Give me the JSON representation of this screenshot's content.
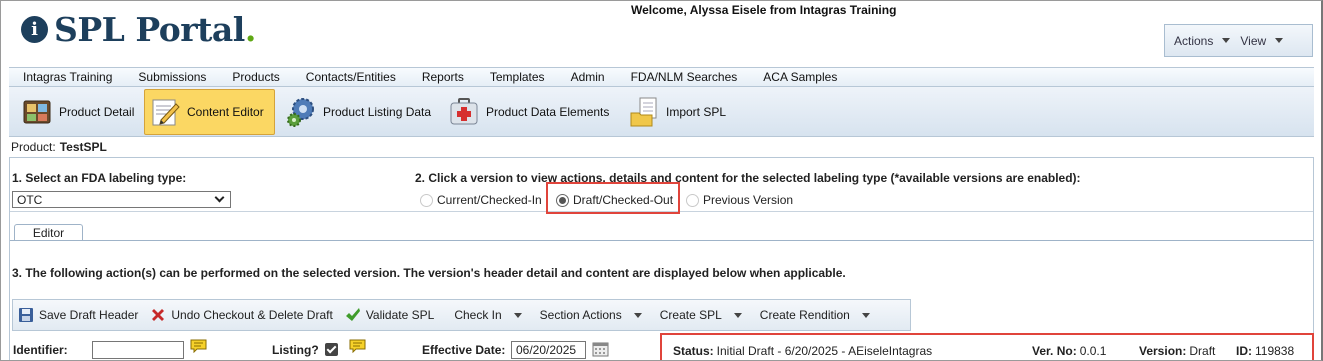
{
  "header": {
    "logo_i": "i",
    "logo_text": "SPL Portal",
    "logo_dot": ".",
    "welcome": "Welcome, Alyssa Eisele from Intagras Training",
    "actions_label": "Actions",
    "view_label": "View"
  },
  "menu": [
    "Intagras Training",
    "Submissions",
    "Products",
    "Contacts/Entities",
    "Reports",
    "Templates",
    "Admin",
    "FDA/NLM Searches",
    "ACA Samples"
  ],
  "toolbar": {
    "product_detail": "Product Detail",
    "content_editor": "Content Editor",
    "product_listing_data": "Product Listing Data",
    "product_data_elements": "Product Data Elements",
    "import_spl": "Import SPL"
  },
  "product": {
    "label": "Product:",
    "name": "TestSPL"
  },
  "step1": {
    "label": "1. Select an FDA labeling type:",
    "selected": "OTC"
  },
  "step2": {
    "label": "2. Click a version to view actions, details and content for the selected labeling type (*available versions are enabled):",
    "options": [
      "Current/Checked-In",
      "Draft/Checked-Out",
      "Previous Version"
    ],
    "selected": "Draft/Checked-Out"
  },
  "tabs": {
    "editor": "Editor"
  },
  "step3": {
    "label": "3. The following action(s) can be performed on the selected version. The version's header detail and content are displayed below when applicable."
  },
  "actions": {
    "save_draft_header": "Save Draft Header",
    "undo_checkout": "Undo Checkout & Delete Draft",
    "validate_spl": "Validate SPL",
    "check_in": "Check In",
    "section_actions": "Section Actions",
    "create_spl": "Create SPL",
    "create_rendition": "Create Rendition"
  },
  "fields": {
    "identifier_label": "Identifier:",
    "identifier_value": "",
    "listing_label": "Listing?",
    "listing_checked": true,
    "effective_date_label": "Effective Date:",
    "effective_date_value": "06/20/2025"
  },
  "status": {
    "status_label": "Status:",
    "status_value": "Initial Draft - 6/20/2025 - AEiseleIntagras",
    "ver_no_label": "Ver. No:",
    "ver_no_value": "0.0.1",
    "version_label": "Version:",
    "version_value": "Draft",
    "id_label": "ID:",
    "id_value": "119838"
  },
  "colors": {
    "brand": "#1d3f5c",
    "accent_green": "#5fa814",
    "highlight": "#e0443b",
    "active_tool": "#fbd763"
  }
}
